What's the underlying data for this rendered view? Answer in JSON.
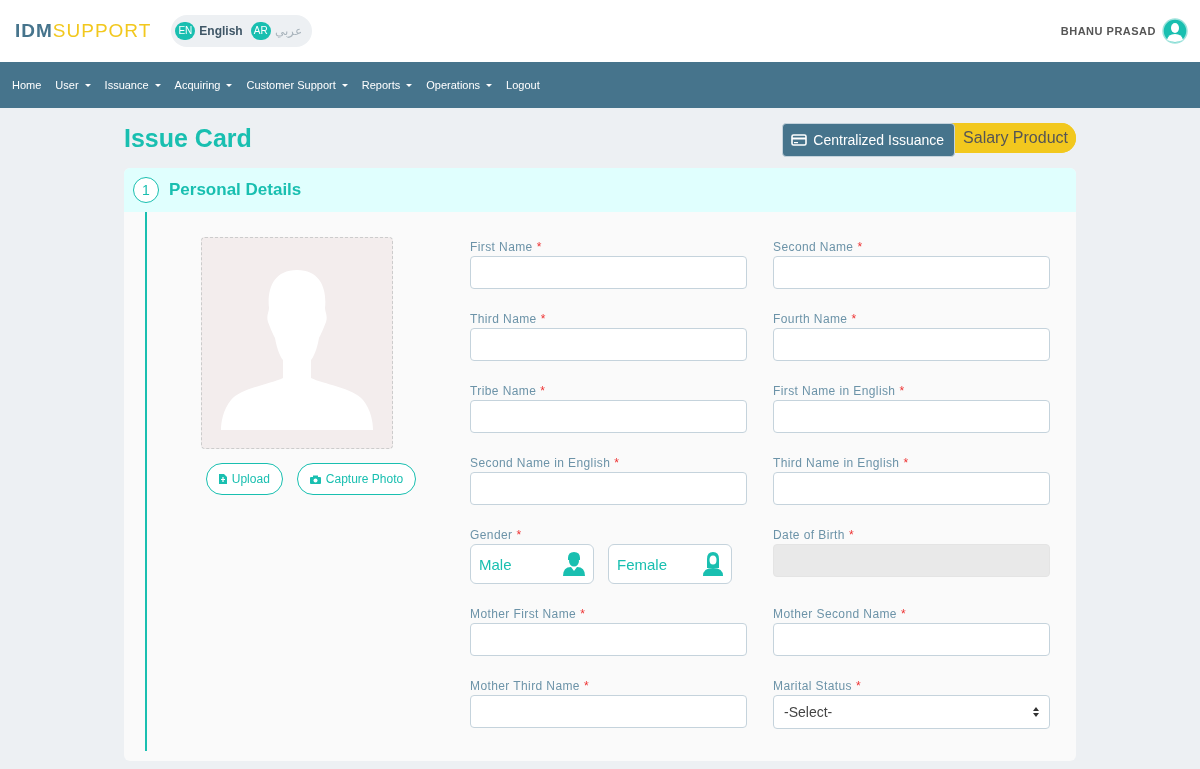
{
  "header": {
    "logo_bold": "IDM",
    "logo_light": "SUPPORT",
    "languages": [
      {
        "code": "EN",
        "label": "English",
        "selected": true
      },
      {
        "code": "AR",
        "label": "عربي",
        "selected": false
      }
    ],
    "user_name": "BHANU PRASAD"
  },
  "nav": [
    {
      "label": "Home",
      "dropdown": false
    },
    {
      "label": "User",
      "dropdown": true
    },
    {
      "label": "Issuance",
      "dropdown": true
    },
    {
      "label": "Acquiring",
      "dropdown": true
    },
    {
      "label": "Customer Support",
      "dropdown": true
    },
    {
      "label": "Reports",
      "dropdown": true
    },
    {
      "label": "Operations",
      "dropdown": true
    },
    {
      "label": "Logout",
      "dropdown": false
    }
  ],
  "page_title": "Issue Card",
  "issuance_toggle": [
    {
      "label": "Centralized Issuance",
      "selected": true
    },
    {
      "label": "Salary Product",
      "selected": false
    }
  ],
  "section": {
    "number": "1",
    "title": "Personal Details"
  },
  "photo_buttons": [
    {
      "label": "Upload",
      "kind": "upload"
    },
    {
      "label": "Capture Photo",
      "kind": "camera"
    }
  ],
  "fields": [
    {
      "label": "First Name",
      "required_mark": "*",
      "kind": "text"
    },
    {
      "label": "Second Name",
      "required_mark": "*",
      "kind": "text"
    },
    {
      "label": "Third Name",
      "required_mark": "*",
      "kind": "text"
    },
    {
      "label": "Fourth Name",
      "required_mark": "*",
      "kind": "text"
    },
    {
      "label": "Tribe Name",
      "required_mark": "*",
      "kind": "text"
    },
    {
      "label": "First Name in English",
      "required_mark": "*",
      "kind": "text"
    },
    {
      "label": "Second Name in English",
      "required_mark": "*",
      "kind": "text"
    },
    {
      "label": "Third Name in English",
      "required_mark": "*",
      "kind": "text"
    },
    {
      "label": "Gender",
      "required_mark": "*",
      "kind": "gender",
      "options": [
        {
          "label": "Male",
          "kind": "male",
          "selected": false
        },
        {
          "label": "Female",
          "kind": "female",
          "selected": false
        }
      ]
    },
    {
      "label": "Date of Birth",
      "required_mark": "*",
      "kind": "text",
      "disabled": true
    },
    {
      "label": "Mother First Name",
      "required_mark": "*",
      "kind": "text"
    },
    {
      "label": "Mother Second Name",
      "required_mark": "*",
      "kind": "text"
    },
    {
      "label": "Mother Third Name",
      "required_mark": "*",
      "kind": "text"
    },
    {
      "label": "Marital Status",
      "required_mark": "*",
      "kind": "select",
      "value": "-Select-"
    }
  ]
}
